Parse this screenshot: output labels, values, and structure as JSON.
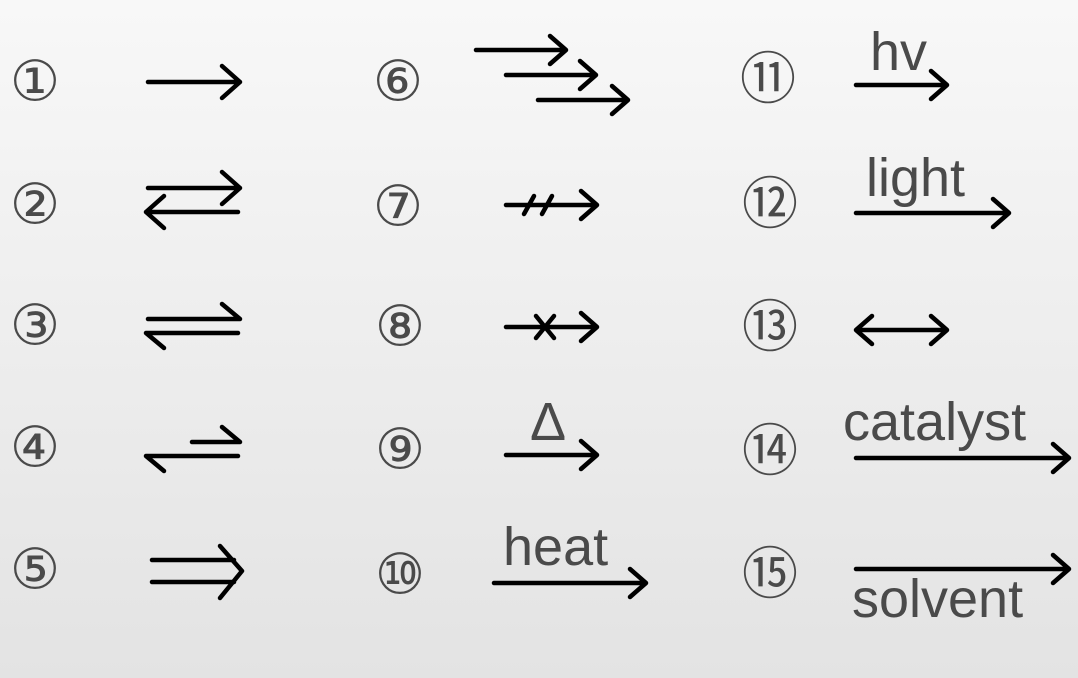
{
  "items": [
    {
      "number": "①",
      "type": "reaction-arrow"
    },
    {
      "number": "②",
      "type": "reversible-arrows"
    },
    {
      "number": "③",
      "type": "equilibrium-harpoons"
    },
    {
      "number": "④",
      "type": "equilibrium-favoring-reverse"
    },
    {
      "number": "⑤",
      "type": "double-arrow"
    },
    {
      "number": "⑥",
      "type": "multistep-arrows"
    },
    {
      "number": "⑦",
      "type": "no-reaction-slashed-arrow"
    },
    {
      "number": "⑧",
      "type": "no-reaction-crossed-arrow"
    },
    {
      "number": "⑨",
      "type": "heat-arrow",
      "label": "Δ"
    },
    {
      "number": "⑩",
      "type": "labeled-arrow",
      "label": "heat"
    },
    {
      "number": "⑪",
      "type": "labeled-arrow",
      "label": "hv"
    },
    {
      "number": "⑫",
      "type": "labeled-arrow",
      "label": "light"
    },
    {
      "number": "⑬",
      "type": "resonance-arrow"
    },
    {
      "number": "⑭",
      "type": "labeled-arrow",
      "label": "catalyst"
    },
    {
      "number": "⑮",
      "type": "labeled-arrow",
      "label": "solvent"
    }
  ]
}
